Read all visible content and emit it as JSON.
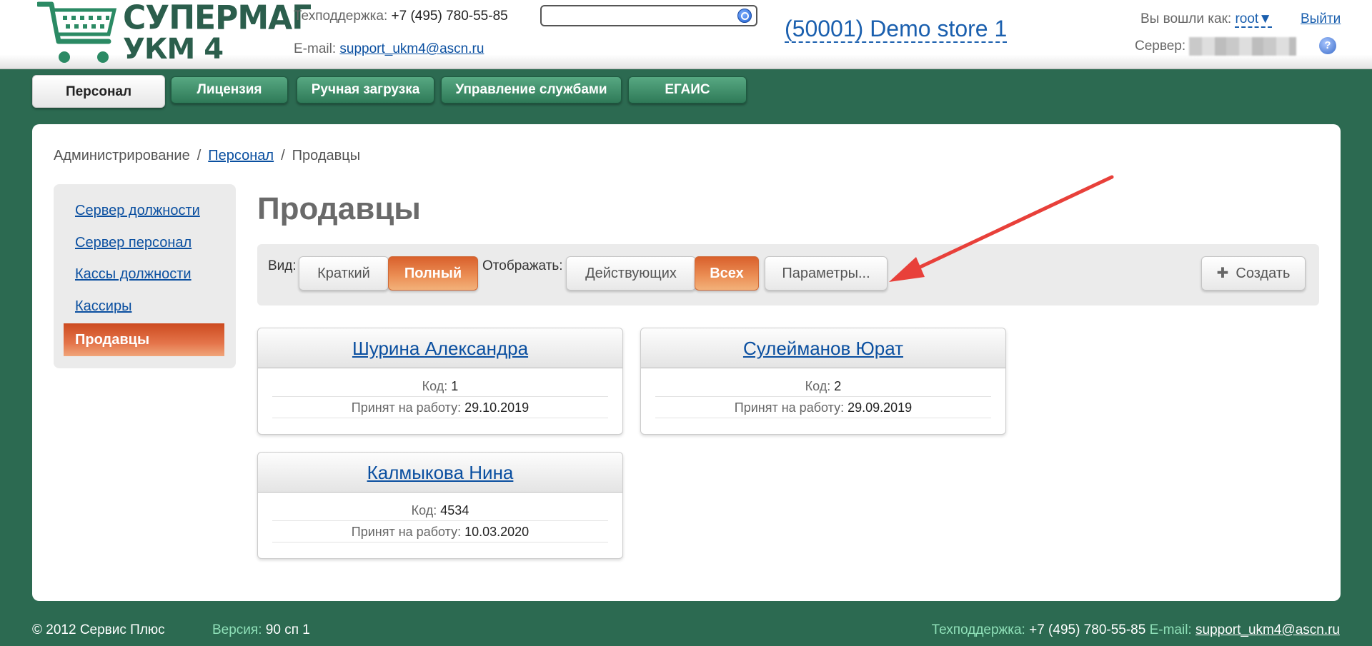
{
  "header": {
    "logo": {
      "line1": "СУПЕРМАГ",
      "line2": "УКМ 4"
    },
    "support_label": "Техподдержка:",
    "support_phone": "+7 (495) 780-55-85",
    "email_label": "E-mail:",
    "email": "support_ukm4@ascn.ru",
    "search": {
      "value": "",
      "placeholder": ""
    },
    "store": "(50001) Demo store 1",
    "login_label": "Вы вошли как:",
    "user": "root▼",
    "logout": "Выйти",
    "server_label": "Сервер:",
    "help": "?"
  },
  "tabs": [
    {
      "label": "Персонал",
      "active": true
    },
    {
      "label": "Лицензия"
    },
    {
      "label": "Ручная загрузка"
    },
    {
      "label": "Управление службами"
    },
    {
      "label": "ЕГАИС"
    }
  ],
  "breadcrumb": {
    "root": "Администрирование",
    "sep": "/",
    "section": "Персонал",
    "current": "Продавцы"
  },
  "sidebar": {
    "items": [
      {
        "label": "Сервер должности"
      },
      {
        "label": "Сервер персонал"
      },
      {
        "label": "Кассы должности"
      },
      {
        "label": "Кассиры"
      },
      {
        "label": "Продавцы",
        "active": true
      }
    ]
  },
  "page_title": "Продавцы",
  "toolbar": {
    "view_label": "Вид:",
    "view_short": "Краткий",
    "view_full": "Полный",
    "show_label": "Отображать:",
    "show_active": "Действующих",
    "show_all": "Всех",
    "params": "Параметры...",
    "create_icon": "✚",
    "create": "Создать"
  },
  "cards": [
    {
      "name": "Шурина Александра",
      "code_label": "Код:",
      "code": "1",
      "hired_label": "Принят на работу:",
      "hired": "29.10.2019"
    },
    {
      "name": "Сулейманов Юрат",
      "code_label": "Код:",
      "code": "2",
      "hired_label": "Принят на работу:",
      "hired": "29.09.2019"
    },
    {
      "name": "Калмыкова Нина",
      "code_label": "Код:",
      "code": "4534",
      "hired_label": "Принят на работу:",
      "hired": "10.03.2020"
    }
  ],
  "footer": {
    "copyright": "© 2012 Сервис Плюс",
    "version_label": "Версия:",
    "version": "90 сп 1",
    "support_label": "Техподдержка:",
    "support_phone": "+7 (495) 780-55-85",
    "email_label": "E-mail:",
    "email": "support_ukm4@ascn.ru"
  },
  "colors": {
    "background": "#2c6a51",
    "accent_orange": "#e4744a",
    "link": "#0a4fa0",
    "annotation_arrow": "#e8403a"
  }
}
